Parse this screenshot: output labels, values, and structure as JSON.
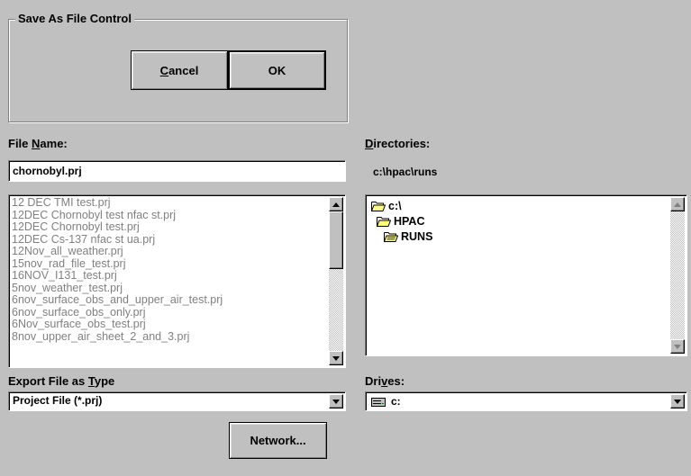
{
  "group": {
    "title": "Save As File Control"
  },
  "buttons": {
    "cancel_mnemonic": "C",
    "cancel_rest": "ancel",
    "ok": "OK",
    "network": "Network..."
  },
  "file_name": {
    "label_pre": "File ",
    "label_mnemonic": "N",
    "label_post": "ame:",
    "value": "chornobyl.prj",
    "files": [
      "12 DEC TMI test.prj",
      "12DEC Chornobyl test nfac st.prj",
      "12DEC Chornobyl test.prj",
      "12DEC Cs-137 nfac st ua.prj",
      "12Nov_all_weather.prj",
      "15nov_rad_file_test.prj",
      "16NOV_I131_test.prj",
      "5nov_weather_test.prj",
      "6nov_surface_obs_and_upper_air_test.prj",
      "6nov_surface_obs_only.prj",
      "6Nov_surface_obs_test.prj",
      "8nov_upper_air_sheet_2_and_3.prj"
    ]
  },
  "directories": {
    "label_mnemonic": "D",
    "label_rest": "irectories:",
    "current_path": "c:\\hpac\\runs",
    "tree": [
      "c:\\",
      "HPAC",
      "RUNS"
    ]
  },
  "export_type": {
    "label_pre": "Export File as ",
    "label_mnemonic": "T",
    "label_post": "ype",
    "selected": "Project File (*.prj)"
  },
  "drives": {
    "label_pre": "Dri",
    "label_mnemonic": "v",
    "label_post": "es:",
    "selected": "c:",
    "icon": "drive-icon"
  },
  "colors": {
    "face": "#c0c0c0",
    "folder": "#ffff80",
    "disabled_text": "#808080"
  }
}
